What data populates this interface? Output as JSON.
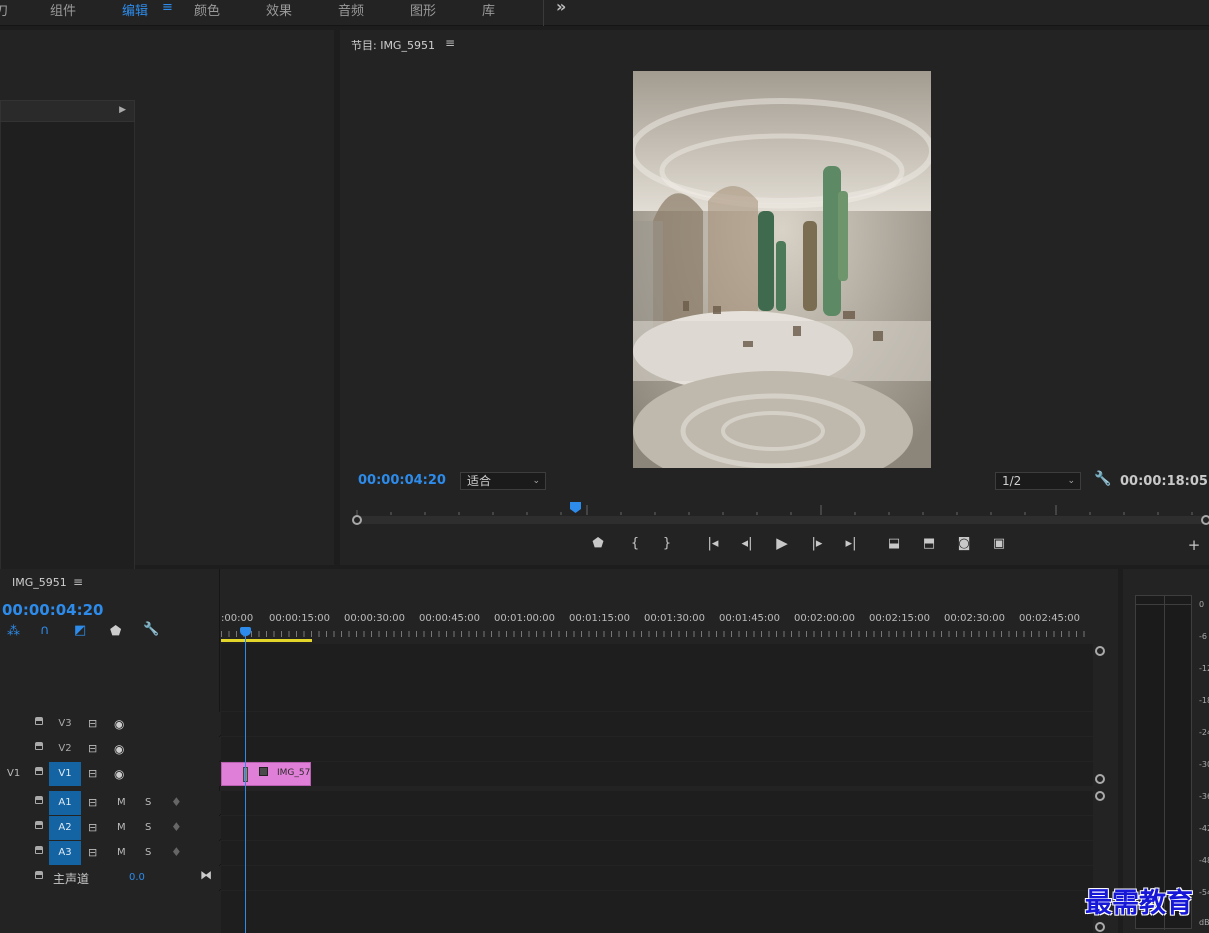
{
  "workspaces": [
    {
      "label": "组件",
      "active": false
    },
    {
      "label": "编辑",
      "active": true
    },
    {
      "label": "颜色",
      "active": false
    },
    {
      "label": "效果",
      "active": false
    },
    {
      "label": "音频",
      "active": false
    },
    {
      "label": "图形",
      "active": false
    },
    {
      "label": "库",
      "active": false
    }
  ],
  "workspace_partial": "刀",
  "more_icon": "»",
  "program_monitor": {
    "title": "节目: IMG_5951",
    "current_timecode": "00:00:04:20",
    "zoom_value": "适合",
    "resolution_value": "1/2",
    "duration_timecode": "00:00:18:05"
  },
  "timeline": {
    "sequence_name": "IMG_5951",
    "current_timecode": "00:00:04:20",
    "ruler_labels": [
      ":00:00",
      "00:00:15:00",
      "00:00:30:00",
      "00:00:45:00",
      "00:01:00:00",
      "00:01:15:00",
      "00:01:30:00",
      "00:01:45:00",
      "00:02:00:00",
      "00:02:15:00",
      "00:02:30:00",
      "00:02:45:00"
    ],
    "video_tracks": [
      {
        "source": "",
        "label": "V3",
        "target": false
      },
      {
        "source": "",
        "label": "V2",
        "target": false
      },
      {
        "source": "V1",
        "label": "V1",
        "target": true
      }
    ],
    "audio_tracks": [
      {
        "label": "A1",
        "m": "M",
        "s": "S"
      },
      {
        "label": "A2",
        "m": "M",
        "s": "S"
      },
      {
        "label": "A3",
        "m": "M",
        "s": "S"
      }
    ],
    "master": {
      "label": "主声道",
      "value": "0.0"
    },
    "clip": {
      "label": "IMG_57",
      "color": "#e07fd7"
    }
  },
  "audio_meter": {
    "labels": [
      "0",
      "-6",
      "-12",
      "-18",
      "-24",
      "-30",
      "-36",
      "-42",
      "-48",
      "-54",
      "dB"
    ]
  },
  "watermark": "最需教育",
  "colors": {
    "accent": "#2d8ceb",
    "background": "#1d1d1d",
    "panel": "#232323"
  }
}
